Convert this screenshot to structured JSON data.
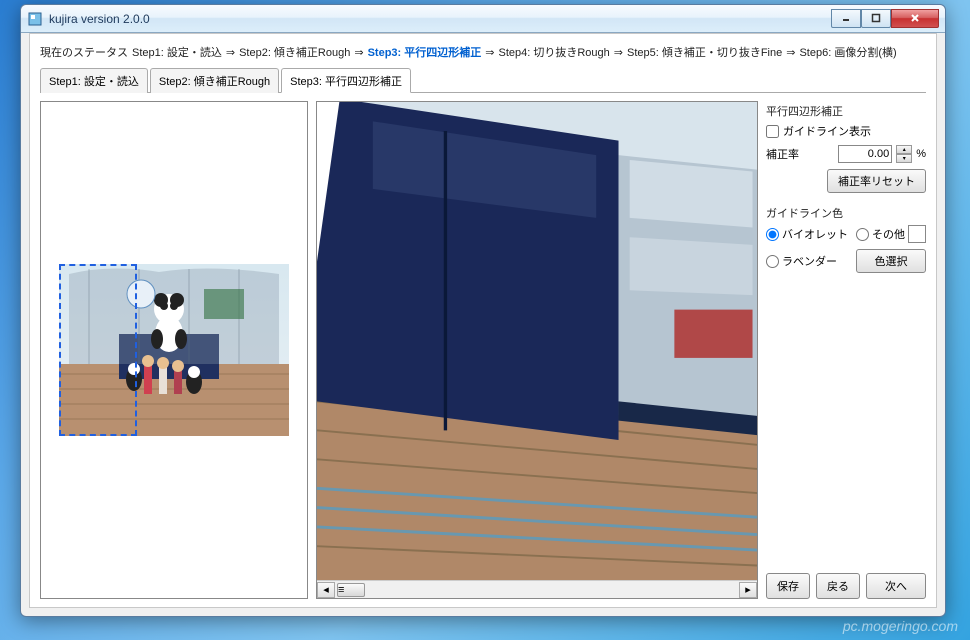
{
  "window": {
    "title": "kujira version 2.0.0"
  },
  "status": {
    "label": "現在のステータス",
    "steps": [
      {
        "label": "Step1: 設定・読込"
      },
      {
        "label": "Step2: 傾き補正Rough"
      },
      {
        "label": "Step3: 平行四辺形補正",
        "active": true
      },
      {
        "label": "Step4: 切り抜きRough"
      },
      {
        "label": "Step5: 傾き補正・切り抜きFine"
      },
      {
        "label": "Step6: 画像分割(横)"
      }
    ]
  },
  "tabs": [
    {
      "label": "Step1: 設定・読込"
    },
    {
      "label": "Step2: 傾き補正Rough"
    },
    {
      "label": "Step3: 平行四辺形補正",
      "active": true
    }
  ],
  "panel": {
    "section_title": "平行四辺形補正",
    "guideline_checkbox": "ガイドライン表示",
    "correction_rate_label": "補正率",
    "correction_rate_value": "0.00",
    "percent": "%",
    "reset_button": "補正率リセット",
    "guideline_color_label": "ガイドライン色",
    "radio_violet": "バイオレット",
    "radio_other": "その他",
    "radio_lavender": "ラベンダー",
    "color_select_button": "色選択"
  },
  "buttons": {
    "save": "保存",
    "back": "戻る",
    "next": "次へ"
  },
  "watermark": "pc.mogeringo.com"
}
